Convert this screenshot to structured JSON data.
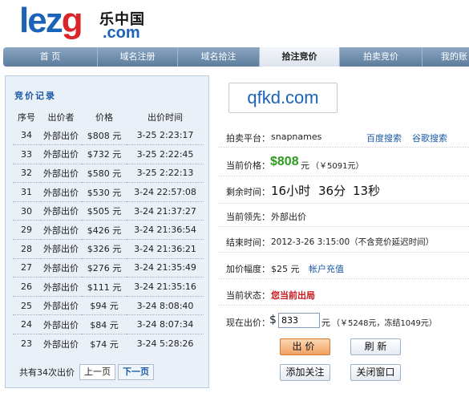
{
  "logo": {
    "l": "l",
    "e": "e",
    "z": "z",
    "g": "g",
    "cn": "乐中国",
    "com": ".com"
  },
  "nav": [
    {
      "label": "首  页",
      "active": false
    },
    {
      "label": "域名注册",
      "active": false
    },
    {
      "label": "域名拾注",
      "active": false
    },
    {
      "label": "拾注竞价",
      "active": true
    },
    {
      "label": "拍卖竞价",
      "active": false
    },
    {
      "label": "我的账",
      "active": false
    }
  ],
  "bid_record": {
    "title": "竞价记录",
    "headers": [
      "序号",
      "出价者",
      "价格",
      "出价时间"
    ],
    "rows": [
      {
        "no": "34",
        "bidder": "外部出价",
        "price": "$808 元",
        "time": "3-25 2:23:17"
      },
      {
        "no": "33",
        "bidder": "外部出价",
        "price": "$732 元",
        "time": "3-25 2:22:45"
      },
      {
        "no": "32",
        "bidder": "外部出价",
        "price": "$580 元",
        "time": "3-25 2:22:13"
      },
      {
        "no": "31",
        "bidder": "外部出价",
        "price": "$530 元",
        "time": "3-24 22:57:08"
      },
      {
        "no": "30",
        "bidder": "外部出价",
        "price": "$505 元",
        "time": "3-24 21:37:27"
      },
      {
        "no": "29",
        "bidder": "外部出价",
        "price": "$426 元",
        "time": "3-24 21:36:54"
      },
      {
        "no": "28",
        "bidder": "外部出价",
        "price": "$326 元",
        "time": "3-24 21:36:21"
      },
      {
        "no": "27",
        "bidder": "外部出价",
        "price": "$276 元",
        "time": "3-24 21:35:49"
      },
      {
        "no": "26",
        "bidder": "外部出价",
        "price": "$111 元",
        "time": "3-24 21:35:16"
      },
      {
        "no": "25",
        "bidder": "外部出价",
        "price": "$94 元",
        "time": "3-24 8:08:40"
      },
      {
        "no": "24",
        "bidder": "外部出价",
        "price": "$84 元",
        "time": "3-24 8:07:34"
      },
      {
        "no": "23",
        "bidder": "外部出价",
        "price": "$74 元",
        "time": "3-24 5:28:26"
      }
    ],
    "total": "共有34次出价",
    "prev": "上一页",
    "next": "下一页"
  },
  "domain": "qfkd.com",
  "platform": {
    "label": "拍卖平台：",
    "value": "snapnames",
    "link1": "百度搜索",
    "link2": "谷歌搜索"
  },
  "current_price": {
    "label": "当前价格：",
    "amount": "$808",
    "unit": "元",
    "rmb": "（￥5091元）"
  },
  "remaining": {
    "label": "剩余时间：",
    "hours": "16小时",
    "minutes": "36分",
    "seconds": "13秒"
  },
  "leader": {
    "label": "当前领先：",
    "value": "外部出价"
  },
  "end_time": {
    "label": "结束时间：",
    "value": "2012-3-26 3:15:00（不含竞价延迟时间）"
  },
  "increment": {
    "label": "加价幅度：",
    "value": "$25 元",
    "link": "帐户充值"
  },
  "status": {
    "label": "当前状态：",
    "value": "您当前出局"
  },
  "bid": {
    "label": "现在出价：",
    "currency": "$",
    "value": "833",
    "unit": "元",
    "note": "（￥5248元，冻结1049元）"
  },
  "buttons": {
    "bid": "出价",
    "refresh": "刷 新",
    "watch": "添加关注",
    "close": "关闭窗口"
  }
}
